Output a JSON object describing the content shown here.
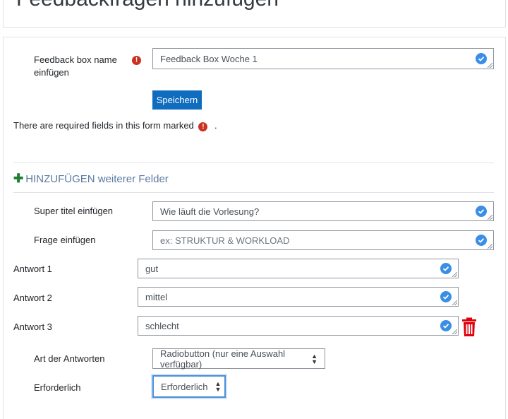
{
  "header": {
    "title": "Feedbackfragen hinzufügen"
  },
  "form": {
    "box_name_label": "Feedback box name einfügen",
    "box_name_value": "Feedback Box Woche 1",
    "save_label": "Speichern",
    "required_note": "There are required fields in this form marked",
    "required_note_suffix": "."
  },
  "add_fields": {
    "label": "HINZUFÜGEN weiterer Felder"
  },
  "question": {
    "super_title_label": "Super titel einfügen",
    "super_title_value": "Wie läuft die Vorlesung?",
    "question_label": "Frage einfügen",
    "question_placeholder": "ex: STRUKTUR & WORKLOAD"
  },
  "answers": [
    {
      "label": "Antwort 1",
      "value": "gut"
    },
    {
      "label": "Antwort 2",
      "value": "mittel"
    },
    {
      "label": "Antwort 3",
      "value": "schlecht"
    }
  ],
  "answer_type": {
    "label": "Art der Antworten",
    "selected": "Radiobutton (nur eine Auswahl verfügbar)"
  },
  "required": {
    "label": "Erforderlich",
    "selected": "Erforderlich"
  },
  "colors": {
    "primary": "#0f6cbf",
    "check": "#3b8ee6",
    "danger": "#ca3120",
    "add": "#1e7e34",
    "trash": "#e0000b"
  }
}
